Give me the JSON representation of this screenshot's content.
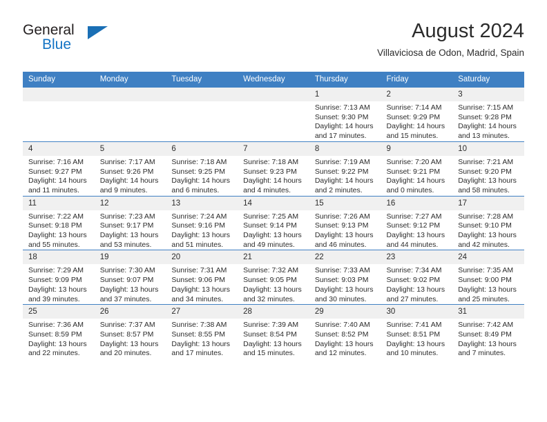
{
  "brand": {
    "line1": "General",
    "line2": "Blue",
    "triangle_icon": "triangle-icon",
    "color_dark": "#231f20",
    "color_blue": "#1273c4"
  },
  "header": {
    "title": "August 2024",
    "subtitle": "Villaviciosa de Odon, Madrid, Spain"
  },
  "theme": {
    "header_bg": "#3f80c3",
    "daynum_bg": "#f0f0f0",
    "text": "#2b2b2b"
  },
  "weekdays": [
    "Sunday",
    "Monday",
    "Tuesday",
    "Wednesday",
    "Thursday",
    "Friday",
    "Saturday"
  ],
  "weeks": [
    [
      {
        "day": "",
        "lines": []
      },
      {
        "day": "",
        "lines": []
      },
      {
        "day": "",
        "lines": []
      },
      {
        "day": "",
        "lines": []
      },
      {
        "day": "1",
        "lines": [
          "Sunrise: 7:13 AM",
          "Sunset: 9:30 PM",
          "Daylight: 14 hours",
          "and 17 minutes."
        ]
      },
      {
        "day": "2",
        "lines": [
          "Sunrise: 7:14 AM",
          "Sunset: 9:29 PM",
          "Daylight: 14 hours",
          "and 15 minutes."
        ]
      },
      {
        "day": "3",
        "lines": [
          "Sunrise: 7:15 AM",
          "Sunset: 9:28 PM",
          "Daylight: 14 hours",
          "and 13 minutes."
        ]
      }
    ],
    [
      {
        "day": "4",
        "lines": [
          "Sunrise: 7:16 AM",
          "Sunset: 9:27 PM",
          "Daylight: 14 hours",
          "and 11 minutes."
        ]
      },
      {
        "day": "5",
        "lines": [
          "Sunrise: 7:17 AM",
          "Sunset: 9:26 PM",
          "Daylight: 14 hours",
          "and 9 minutes."
        ]
      },
      {
        "day": "6",
        "lines": [
          "Sunrise: 7:18 AM",
          "Sunset: 9:25 PM",
          "Daylight: 14 hours",
          "and 6 minutes."
        ]
      },
      {
        "day": "7",
        "lines": [
          "Sunrise: 7:18 AM",
          "Sunset: 9:23 PM",
          "Daylight: 14 hours",
          "and 4 minutes."
        ]
      },
      {
        "day": "8",
        "lines": [
          "Sunrise: 7:19 AM",
          "Sunset: 9:22 PM",
          "Daylight: 14 hours",
          "and 2 minutes."
        ]
      },
      {
        "day": "9",
        "lines": [
          "Sunrise: 7:20 AM",
          "Sunset: 9:21 PM",
          "Daylight: 14 hours",
          "and 0 minutes."
        ]
      },
      {
        "day": "10",
        "lines": [
          "Sunrise: 7:21 AM",
          "Sunset: 9:20 PM",
          "Daylight: 13 hours",
          "and 58 minutes."
        ]
      }
    ],
    [
      {
        "day": "11",
        "lines": [
          "Sunrise: 7:22 AM",
          "Sunset: 9:18 PM",
          "Daylight: 13 hours",
          "and 55 minutes."
        ]
      },
      {
        "day": "12",
        "lines": [
          "Sunrise: 7:23 AM",
          "Sunset: 9:17 PM",
          "Daylight: 13 hours",
          "and 53 minutes."
        ]
      },
      {
        "day": "13",
        "lines": [
          "Sunrise: 7:24 AM",
          "Sunset: 9:16 PM",
          "Daylight: 13 hours",
          "and 51 minutes."
        ]
      },
      {
        "day": "14",
        "lines": [
          "Sunrise: 7:25 AM",
          "Sunset: 9:14 PM",
          "Daylight: 13 hours",
          "and 49 minutes."
        ]
      },
      {
        "day": "15",
        "lines": [
          "Sunrise: 7:26 AM",
          "Sunset: 9:13 PM",
          "Daylight: 13 hours",
          "and 46 minutes."
        ]
      },
      {
        "day": "16",
        "lines": [
          "Sunrise: 7:27 AM",
          "Sunset: 9:12 PM",
          "Daylight: 13 hours",
          "and 44 minutes."
        ]
      },
      {
        "day": "17",
        "lines": [
          "Sunrise: 7:28 AM",
          "Sunset: 9:10 PM",
          "Daylight: 13 hours",
          "and 42 minutes."
        ]
      }
    ],
    [
      {
        "day": "18",
        "lines": [
          "Sunrise: 7:29 AM",
          "Sunset: 9:09 PM",
          "Daylight: 13 hours",
          "and 39 minutes."
        ]
      },
      {
        "day": "19",
        "lines": [
          "Sunrise: 7:30 AM",
          "Sunset: 9:07 PM",
          "Daylight: 13 hours",
          "and 37 minutes."
        ]
      },
      {
        "day": "20",
        "lines": [
          "Sunrise: 7:31 AM",
          "Sunset: 9:06 PM",
          "Daylight: 13 hours",
          "and 34 minutes."
        ]
      },
      {
        "day": "21",
        "lines": [
          "Sunrise: 7:32 AM",
          "Sunset: 9:05 PM",
          "Daylight: 13 hours",
          "and 32 minutes."
        ]
      },
      {
        "day": "22",
        "lines": [
          "Sunrise: 7:33 AM",
          "Sunset: 9:03 PM",
          "Daylight: 13 hours",
          "and 30 minutes."
        ]
      },
      {
        "day": "23",
        "lines": [
          "Sunrise: 7:34 AM",
          "Sunset: 9:02 PM",
          "Daylight: 13 hours",
          "and 27 minutes."
        ]
      },
      {
        "day": "24",
        "lines": [
          "Sunrise: 7:35 AM",
          "Sunset: 9:00 PM",
          "Daylight: 13 hours",
          "and 25 minutes."
        ]
      }
    ],
    [
      {
        "day": "25",
        "lines": [
          "Sunrise: 7:36 AM",
          "Sunset: 8:59 PM",
          "Daylight: 13 hours",
          "and 22 minutes."
        ]
      },
      {
        "day": "26",
        "lines": [
          "Sunrise: 7:37 AM",
          "Sunset: 8:57 PM",
          "Daylight: 13 hours",
          "and 20 minutes."
        ]
      },
      {
        "day": "27",
        "lines": [
          "Sunrise: 7:38 AM",
          "Sunset: 8:55 PM",
          "Daylight: 13 hours",
          "and 17 minutes."
        ]
      },
      {
        "day": "28",
        "lines": [
          "Sunrise: 7:39 AM",
          "Sunset: 8:54 PM",
          "Daylight: 13 hours",
          "and 15 minutes."
        ]
      },
      {
        "day": "29",
        "lines": [
          "Sunrise: 7:40 AM",
          "Sunset: 8:52 PM",
          "Daylight: 13 hours",
          "and 12 minutes."
        ]
      },
      {
        "day": "30",
        "lines": [
          "Sunrise: 7:41 AM",
          "Sunset: 8:51 PM",
          "Daylight: 13 hours",
          "and 10 minutes."
        ]
      },
      {
        "day": "31",
        "lines": [
          "Sunrise: 7:42 AM",
          "Sunset: 8:49 PM",
          "Daylight: 13 hours",
          "and 7 minutes."
        ]
      }
    ]
  ]
}
